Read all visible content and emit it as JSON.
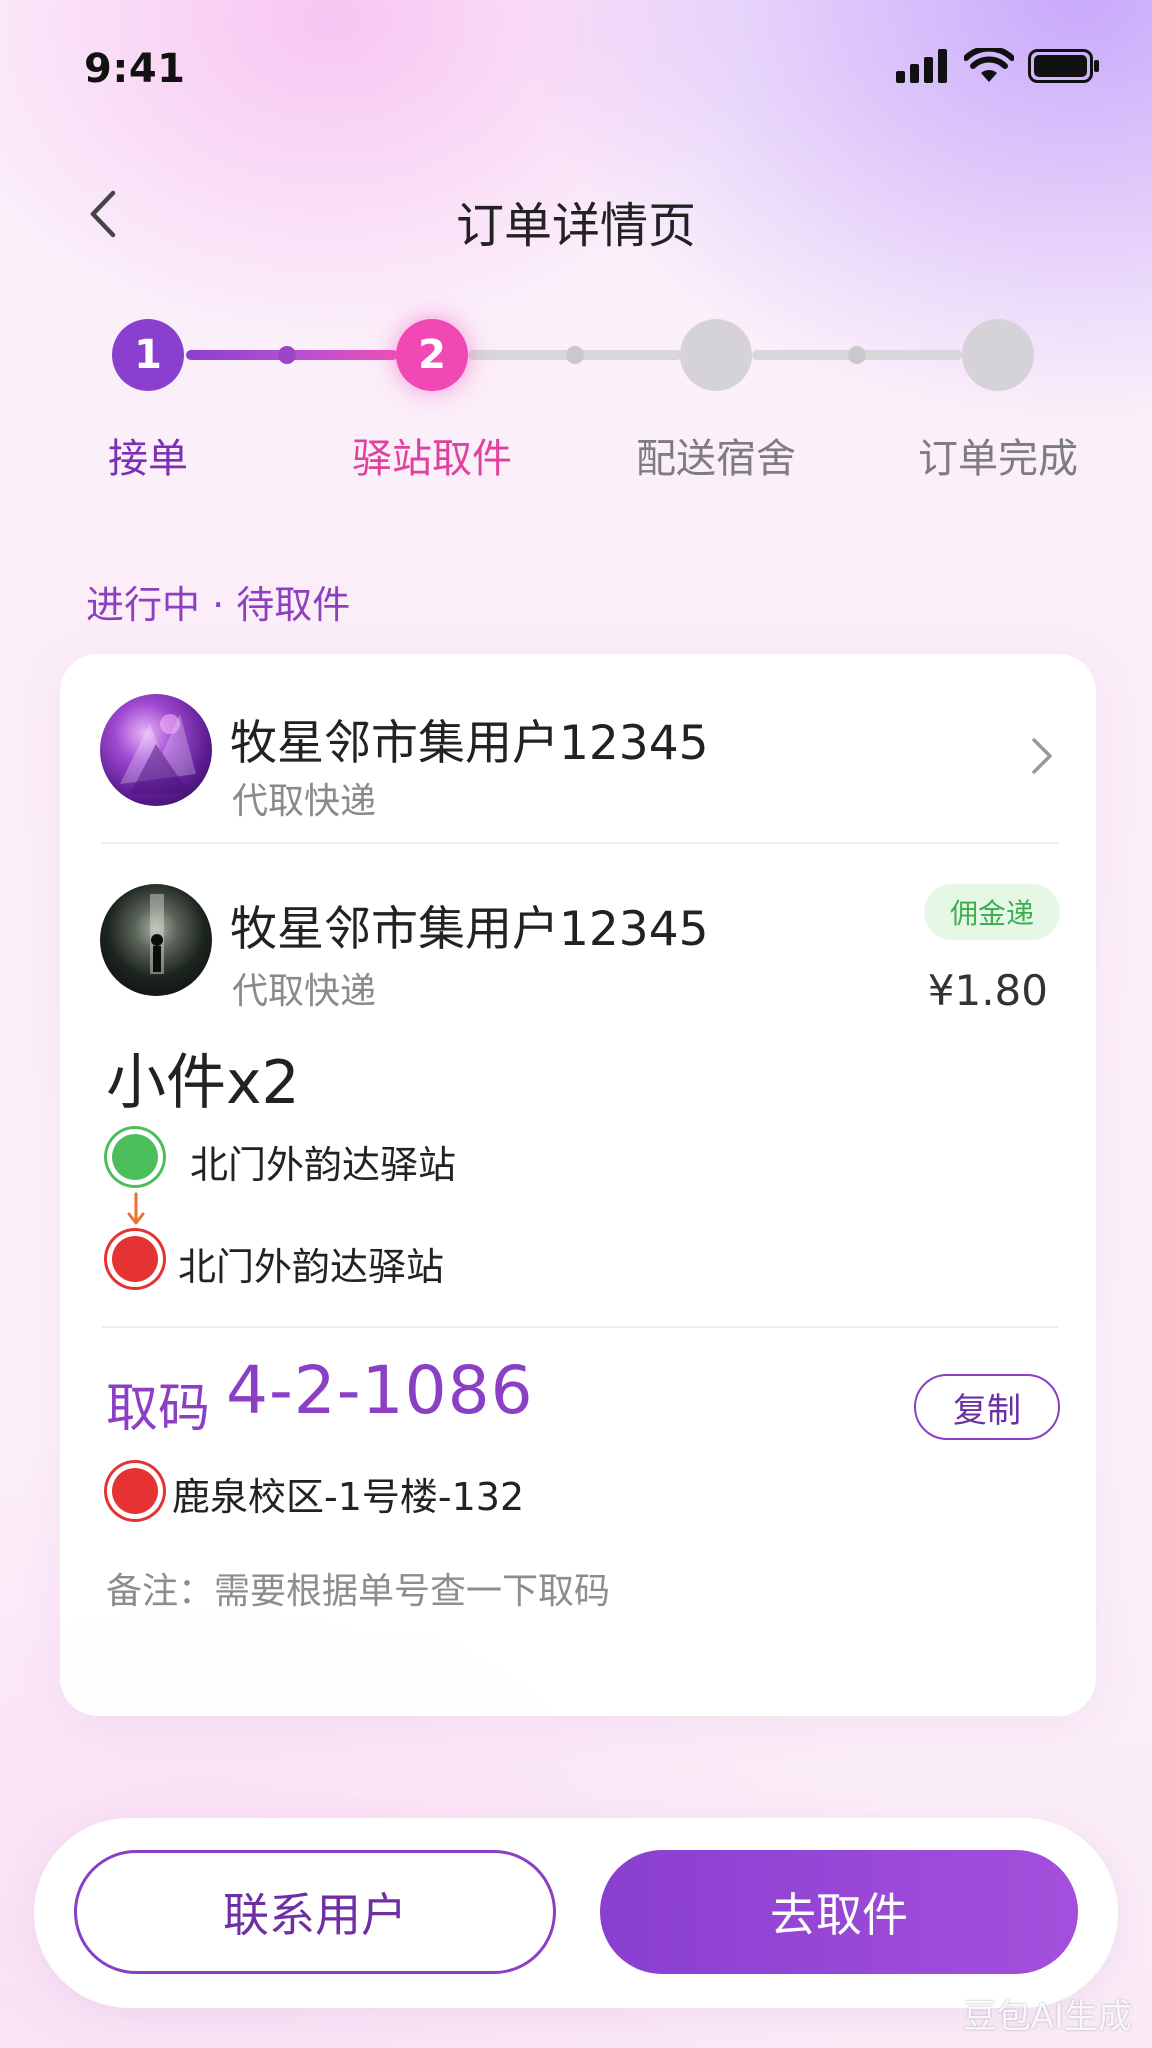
{
  "status_bar": {
    "time": "9:41"
  },
  "header": {
    "title": "订单详情页"
  },
  "stepper": {
    "steps": [
      {
        "number": "1",
        "label": "接单",
        "state": "done"
      },
      {
        "number": "2",
        "label": "驿站取件",
        "state": "active"
      },
      {
        "number": "",
        "label": "配送宿舍",
        "state": "pending"
      },
      {
        "number": "",
        "label": "订单完成",
        "state": "pending"
      }
    ]
  },
  "order_status": "进行中 · 待取件",
  "requester": {
    "name": "牧星邻市集用户12345",
    "type": "代取快递"
  },
  "order": {
    "user_name": "牧星邻市集用户12345",
    "type": "代取快递",
    "badge": "佣金递",
    "price": "¥1.80",
    "item": "小件x2",
    "from": "北门外韵达驿站",
    "to": "北门外韵达驿站",
    "pickup_label": "取码",
    "pickup_code": "4-2-1086",
    "copy_label": "复制",
    "destination": "鹿泉校区-1号楼-132",
    "remark": "备注：需要根据单号查一下取码"
  },
  "actions": {
    "contact": "联系用户",
    "go": "去取件"
  },
  "watermark": "豆包AI生成",
  "colors": {
    "accent": "#8a3fc4",
    "active_step": "#f048b4",
    "green": "#4cbf5c",
    "red": "#e53232"
  }
}
